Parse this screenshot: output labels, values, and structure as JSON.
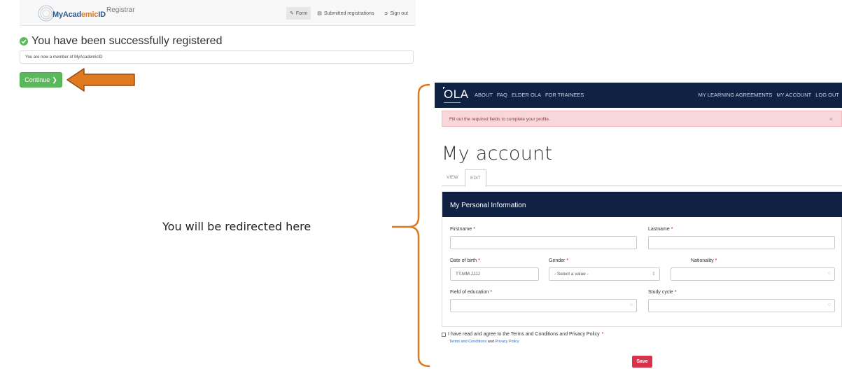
{
  "myacademicid": {
    "logo_text_main": "MyAcad",
    "logo_text_accent": "emic",
    "logo_text_end": "ID",
    "section": "Registrar",
    "nav": [
      {
        "label": "Form",
        "icon": "edit-icon",
        "active": true
      },
      {
        "label": "Submitted registrations",
        "icon": "list-icon",
        "active": false
      },
      {
        "label": "Sign out",
        "icon": "sign-out-icon",
        "active": false
      }
    ],
    "success_title": "You have been successfully registered",
    "message": "You are now a member of MyAcademicID",
    "continue_label": "Continue"
  },
  "annotation": {
    "text": "You will be redirected here"
  },
  "ola": {
    "brand": "OLA",
    "menu_left": [
      "ABOUT",
      "FAQ",
      "ELDER OLA",
      "FOR TRAINEES"
    ],
    "menu_right": [
      "MY LEARNING AGREEMENTS",
      "MY ACCOUNT",
      "LOG OUT"
    ],
    "alert": "Fill out the required fields to complete your profile.",
    "alert_close": "×",
    "page_title": "My account",
    "tabs": [
      "VIEW",
      "EDIT"
    ],
    "section_title": "My Personal Information",
    "fields": {
      "firstname": "Firstname",
      "lastname": "Lastname",
      "dob": "Date of birth",
      "dob_placeholder": "TT.MM.JJJJ",
      "gender": "Gender",
      "gender_value": "- Select a value -",
      "nationality": "Nationality",
      "field_of_education": "Field of education",
      "study_cycle": "Study cycle"
    },
    "required_mark": "*",
    "agree_text": "I have read and agree to the Terms and Conditions and Privacy Policy",
    "terms_link": "Terms and Conditions",
    "and_text": "and",
    "privacy_link": "Privacy Policy",
    "save_label": "Save"
  },
  "colors": {
    "ola_navy": "#0f2244",
    "success_green": "#5cb85c",
    "save_red": "#d9334b",
    "arrow_orange": "#e07a20",
    "alert_pink": "#f8d7da"
  }
}
